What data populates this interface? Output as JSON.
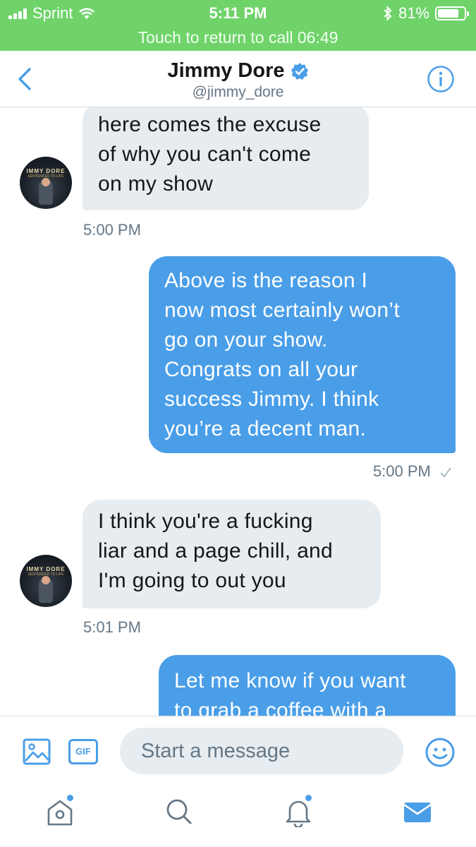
{
  "status_bar": {
    "carrier": "Sprint",
    "time": "5:11 PM",
    "battery": "81%",
    "battery_level": 0.81,
    "call_banner": "Touch to return to call 06:49"
  },
  "header": {
    "title": "Jimmy Dore",
    "handle": "@jimmy_dore",
    "verified": true,
    "back_icon": "chevron-left-icon",
    "info_icon": "info-icon"
  },
  "messages": [
    {
      "direction": "incoming",
      "lines": [
        "here comes the excuse",
        "of why you can't come",
        "on my show"
      ],
      "time": "5:00 PM"
    },
    {
      "direction": "outgoing",
      "lines": [
        "Above is the reason I",
        "now most certainly won’t",
        "go on your show.",
        "Congrats on all your",
        "success Jimmy. I think",
        "you’re a decent man."
      ],
      "time": "5:00 PM"
    },
    {
      "direction": "incoming",
      "lines": [
        "I think you're a fucking",
        "liar and a page chill, and",
        "I'm going to out you"
      ],
      "time": "5:01 PM"
    },
    {
      "direction": "outgoing",
      "lines": [
        "Let me know if you want",
        "to grab a coffee with a"
      ]
    }
  ],
  "avatar": {
    "text": "IMMY DORE",
    "subtext": "SENTENCED TO LIFE"
  },
  "compose": {
    "placeholder": "Start a message",
    "gif_label": "GIF"
  },
  "tabbar": {
    "items": [
      "home-icon",
      "search-icon",
      "notifications-icon",
      "messages-icon"
    ]
  },
  "colors": {
    "status_green": "#6fd36a",
    "accent_blue": "#4a9ee8",
    "incoming_bubble": "#e6ecf0",
    "muted_text": "#657786"
  }
}
